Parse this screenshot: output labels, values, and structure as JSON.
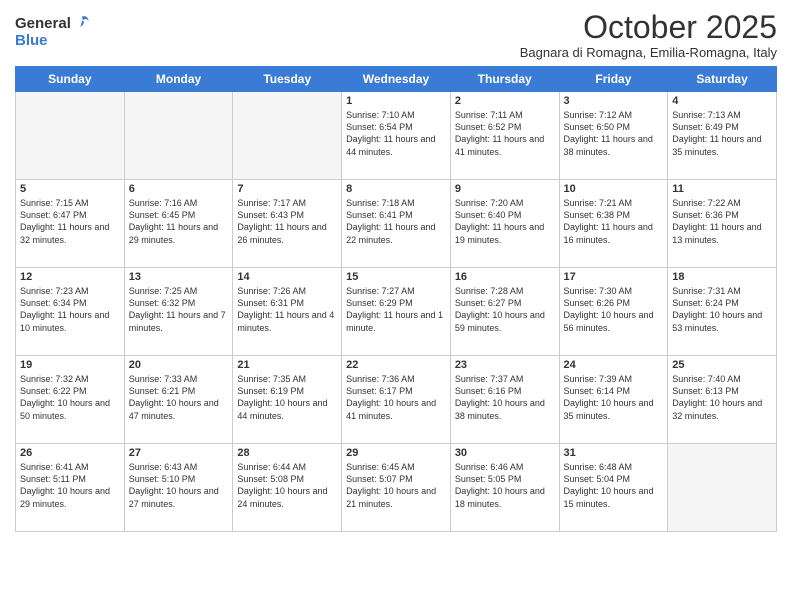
{
  "header": {
    "logo_general": "General",
    "logo_blue": "Blue",
    "month_title": "October 2025",
    "location": "Bagnara di Romagna, Emilia-Romagna, Italy"
  },
  "days_of_week": [
    "Sunday",
    "Monday",
    "Tuesday",
    "Wednesday",
    "Thursday",
    "Friday",
    "Saturday"
  ],
  "weeks": [
    [
      {
        "day": "",
        "empty": true
      },
      {
        "day": "",
        "empty": true
      },
      {
        "day": "",
        "empty": true
      },
      {
        "day": "1",
        "sunrise": "7:10 AM",
        "sunset": "6:54 PM",
        "daylight": "11 hours and 44 minutes."
      },
      {
        "day": "2",
        "sunrise": "7:11 AM",
        "sunset": "6:52 PM",
        "daylight": "11 hours and 41 minutes."
      },
      {
        "day": "3",
        "sunrise": "7:12 AM",
        "sunset": "6:50 PM",
        "daylight": "11 hours and 38 minutes."
      },
      {
        "day": "4",
        "sunrise": "7:13 AM",
        "sunset": "6:49 PM",
        "daylight": "11 hours and 35 minutes."
      }
    ],
    [
      {
        "day": "5",
        "sunrise": "7:15 AM",
        "sunset": "6:47 PM",
        "daylight": "11 hours and 32 minutes."
      },
      {
        "day": "6",
        "sunrise": "7:16 AM",
        "sunset": "6:45 PM",
        "daylight": "11 hours and 29 minutes."
      },
      {
        "day": "7",
        "sunrise": "7:17 AM",
        "sunset": "6:43 PM",
        "daylight": "11 hours and 26 minutes."
      },
      {
        "day": "8",
        "sunrise": "7:18 AM",
        "sunset": "6:41 PM",
        "daylight": "11 hours and 22 minutes."
      },
      {
        "day": "9",
        "sunrise": "7:20 AM",
        "sunset": "6:40 PM",
        "daylight": "11 hours and 19 minutes."
      },
      {
        "day": "10",
        "sunrise": "7:21 AM",
        "sunset": "6:38 PM",
        "daylight": "11 hours and 16 minutes."
      },
      {
        "day": "11",
        "sunrise": "7:22 AM",
        "sunset": "6:36 PM",
        "daylight": "11 hours and 13 minutes."
      }
    ],
    [
      {
        "day": "12",
        "sunrise": "7:23 AM",
        "sunset": "6:34 PM",
        "daylight": "11 hours and 10 minutes."
      },
      {
        "day": "13",
        "sunrise": "7:25 AM",
        "sunset": "6:32 PM",
        "daylight": "11 hours and 7 minutes."
      },
      {
        "day": "14",
        "sunrise": "7:26 AM",
        "sunset": "6:31 PM",
        "daylight": "11 hours and 4 minutes."
      },
      {
        "day": "15",
        "sunrise": "7:27 AM",
        "sunset": "6:29 PM",
        "daylight": "11 hours and 1 minute."
      },
      {
        "day": "16",
        "sunrise": "7:28 AM",
        "sunset": "6:27 PM",
        "daylight": "10 hours and 59 minutes."
      },
      {
        "day": "17",
        "sunrise": "7:30 AM",
        "sunset": "6:26 PM",
        "daylight": "10 hours and 56 minutes."
      },
      {
        "day": "18",
        "sunrise": "7:31 AM",
        "sunset": "6:24 PM",
        "daylight": "10 hours and 53 minutes."
      }
    ],
    [
      {
        "day": "19",
        "sunrise": "7:32 AM",
        "sunset": "6:22 PM",
        "daylight": "10 hours and 50 minutes."
      },
      {
        "day": "20",
        "sunrise": "7:33 AM",
        "sunset": "6:21 PM",
        "daylight": "10 hours and 47 minutes."
      },
      {
        "day": "21",
        "sunrise": "7:35 AM",
        "sunset": "6:19 PM",
        "daylight": "10 hours and 44 minutes."
      },
      {
        "day": "22",
        "sunrise": "7:36 AM",
        "sunset": "6:17 PM",
        "daylight": "10 hours and 41 minutes."
      },
      {
        "day": "23",
        "sunrise": "7:37 AM",
        "sunset": "6:16 PM",
        "daylight": "10 hours and 38 minutes."
      },
      {
        "day": "24",
        "sunrise": "7:39 AM",
        "sunset": "6:14 PM",
        "daylight": "10 hours and 35 minutes."
      },
      {
        "day": "25",
        "sunrise": "7:40 AM",
        "sunset": "6:13 PM",
        "daylight": "10 hours and 32 minutes."
      }
    ],
    [
      {
        "day": "26",
        "sunrise": "6:41 AM",
        "sunset": "5:11 PM",
        "daylight": "10 hours and 29 minutes."
      },
      {
        "day": "27",
        "sunrise": "6:43 AM",
        "sunset": "5:10 PM",
        "daylight": "10 hours and 27 minutes."
      },
      {
        "day": "28",
        "sunrise": "6:44 AM",
        "sunset": "5:08 PM",
        "daylight": "10 hours and 24 minutes."
      },
      {
        "day": "29",
        "sunrise": "6:45 AM",
        "sunset": "5:07 PM",
        "daylight": "10 hours and 21 minutes."
      },
      {
        "day": "30",
        "sunrise": "6:46 AM",
        "sunset": "5:05 PM",
        "daylight": "10 hours and 18 minutes."
      },
      {
        "day": "31",
        "sunrise": "6:48 AM",
        "sunset": "5:04 PM",
        "daylight": "10 hours and 15 minutes."
      },
      {
        "day": "",
        "empty": true
      }
    ]
  ]
}
